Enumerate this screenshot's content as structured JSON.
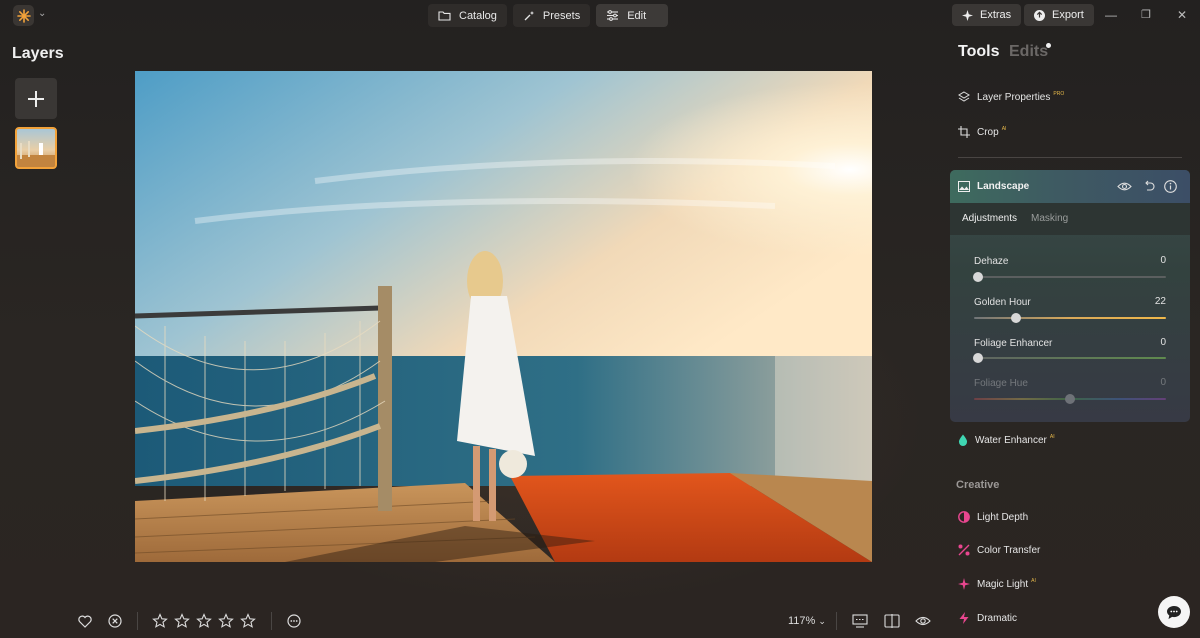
{
  "topbar": {
    "modes": [
      {
        "label": "Catalog",
        "icon": "folder-icon"
      },
      {
        "label": "Presets",
        "icon": "sparkle-wand-icon"
      },
      {
        "label": "Edit",
        "icon": "sliders-icon",
        "active": true
      }
    ],
    "extras_label": "Extras",
    "export_label": "Export"
  },
  "layers": {
    "title": "Layers"
  },
  "bottom_bar": {
    "rating_stars": 0,
    "zoom": "117%"
  },
  "right_panel": {
    "tabs": {
      "tools": "Tools",
      "edits": "Edits"
    },
    "tools": [
      {
        "label": "Layer Properties",
        "badge": "PRO",
        "icon": "layers-icon"
      },
      {
        "label": "Crop",
        "badge": "AI",
        "icon": "crop-icon"
      }
    ],
    "landscape": {
      "title": "Landscape",
      "subtabs": [
        "Adjustments",
        "Masking"
      ],
      "sliders": [
        {
          "label": "Dehaze",
          "value": "0",
          "fraction": 0.0
        },
        {
          "label": "Golden Hour",
          "value": "22",
          "fraction": 0.22
        },
        {
          "label": "Foliage Enhancer",
          "value": "0",
          "fraction": 0.0
        },
        {
          "label": "Foliage Hue",
          "value": "0",
          "fraction": 0.5,
          "disabled": true
        }
      ]
    },
    "water_enhancer": {
      "label": "Water Enhancer",
      "badge": "AI"
    },
    "creative": {
      "title": "Creative",
      "items": [
        {
          "label": "Light Depth",
          "badge": "",
          "icon": "light-depth-icon"
        },
        {
          "label": "Color Transfer",
          "badge": "",
          "icon": "color-transfer-icon"
        },
        {
          "label": "Magic Light",
          "badge": "AI",
          "icon": "magic-light-icon"
        },
        {
          "label": "Dramatic",
          "badge": "",
          "icon": "dramatic-icon"
        }
      ]
    }
  },
  "colors": {
    "accent_orange": "#f2a23a",
    "badge_gold": "#e6b84a",
    "creative_pink": "#e8468f"
  }
}
